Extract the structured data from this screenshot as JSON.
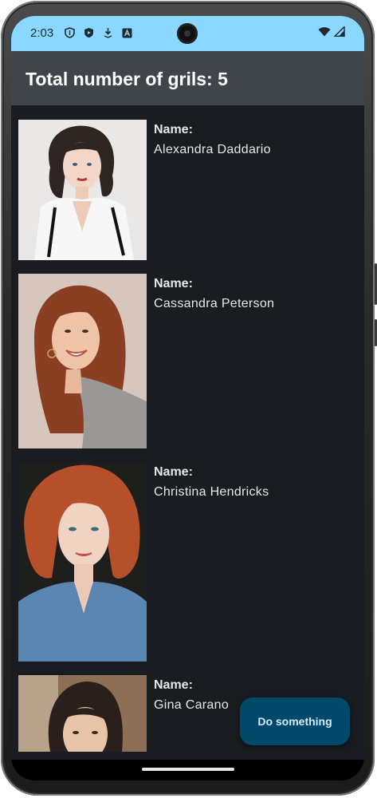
{
  "status_bar": {
    "time": "2:03",
    "left_icons": [
      "shield-icon",
      "play-protect-icon",
      "download-icon",
      "app-a-icon"
    ],
    "right_icons": [
      "wifi-icon",
      "signal-icon"
    ],
    "color": "#8ad8ff"
  },
  "app_bar": {
    "title": "Total number of grils: 5",
    "color": "#3f454b"
  },
  "list": {
    "items": [
      {
        "label": "Name:",
        "name": "Alexandra Daddario"
      },
      {
        "label": "Name:",
        "name": "Cassandra Peterson"
      },
      {
        "label": "Name:",
        "name": "Christina Hendricks"
      },
      {
        "label": "Name:",
        "name": "Gina Carano"
      }
    ]
  },
  "fab": {
    "label": "Do something",
    "color": "#00496a"
  },
  "theme": {
    "background": "#191c20",
    "text": "#e6e8eb"
  }
}
